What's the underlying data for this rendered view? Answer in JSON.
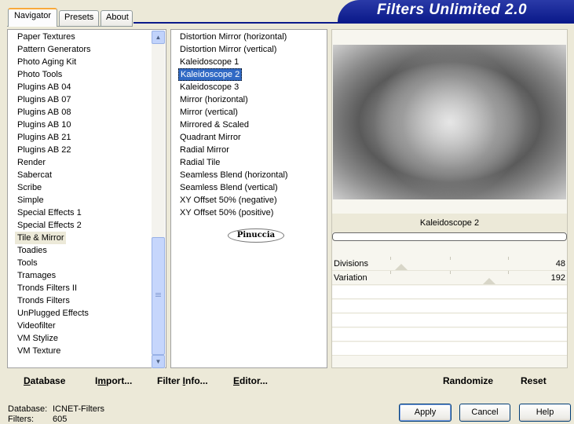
{
  "tabs": [
    {
      "label": "Navigator",
      "active": true
    },
    {
      "label": "Presets",
      "active": false
    },
    {
      "label": "About",
      "active": false
    }
  ],
  "banner": {
    "title": "Filters Unlimited 2.0"
  },
  "categories": {
    "items": [
      "Paper Textures",
      "Pattern Generators",
      "Photo Aging Kit",
      "Photo Tools",
      "Plugins AB 04",
      "Plugins AB 07",
      "Plugins AB 08",
      "Plugins AB 10",
      "Plugins AB 21",
      "Plugins AB 22",
      "Render",
      "Sabercat",
      "Scribe",
      "Simple",
      "Special Effects 1",
      "Special Effects 2",
      "Tile & Mirror",
      "Toadies",
      "Tools",
      "Tramages",
      "Tronds Filters II",
      "Tronds Filters",
      "UnPlugged Effects",
      "Videofilter",
      "VM Stylize",
      "VM Texture"
    ],
    "selected": "Tile & Mirror"
  },
  "filters": {
    "items": [
      "Distortion Mirror (horizontal)",
      "Distortion Mirror (vertical)",
      "Kaleidoscope 1",
      "Kaleidoscope 2",
      "Kaleidoscope 3",
      "Mirror (horizontal)",
      "Mirror (vertical)",
      "Mirrored & Scaled",
      "Quadrant Mirror",
      "Radial Mirror",
      "Radial Tile",
      "Seamless Blend (horizontal)",
      "Seamless Blend (vertical)",
      "XY Offset 50% (negative)",
      "XY Offset 50% (positive)"
    ],
    "selected": "Kaleidoscope 2",
    "logo_text": "Pinuccia"
  },
  "preview": {
    "filter_name": "Kaleidoscope 2"
  },
  "params": [
    {
      "label": "Divisions",
      "value": "48",
      "level": 0.19
    },
    {
      "label": "Variation",
      "value": "192",
      "level": 0.75
    }
  ],
  "toolbar": {
    "database": {
      "u": "D",
      "rest": "atabase"
    },
    "import": {
      "pre": "I",
      "u": "m",
      "rest": "port..."
    },
    "filter_info": {
      "pre": "Filter ",
      "u": "I",
      "rest": "nfo..."
    },
    "editor": {
      "u": "E",
      "rest": "ditor..."
    },
    "randomize": "Randomize",
    "reset": "Reset"
  },
  "status": {
    "database_label": "Database:",
    "database_value": "ICNET-Filters",
    "filters_label": "Filters:",
    "filters_value": "605"
  },
  "buttons": {
    "apply": "Apply",
    "cancel": "Cancel",
    "help": "Help"
  }
}
